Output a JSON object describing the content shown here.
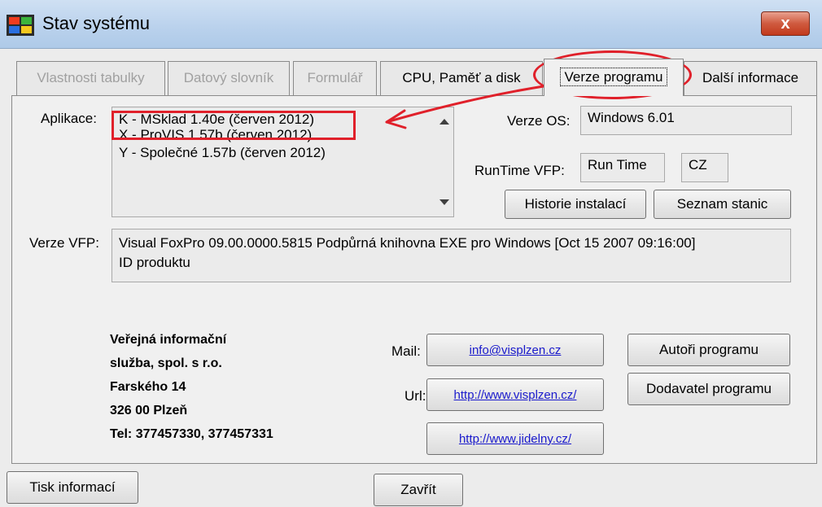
{
  "window": {
    "title": "Stav systému",
    "close": "x"
  },
  "tabs": [
    {
      "label": "Vlastnosti tabulky",
      "enabled": false
    },
    {
      "label": "Datový slovník",
      "enabled": false
    },
    {
      "label": "Formulář",
      "enabled": false
    },
    {
      "label": "CPU, Paměť a disk",
      "enabled": true
    },
    {
      "label": "Verze programu",
      "enabled": true,
      "active": true
    },
    {
      "label": "Další informace",
      "enabled": true
    }
  ],
  "applications": {
    "label": "Aplikace:",
    "items": [
      "K - MSklad 1.40e  (červen 2012)",
      "X - ProVIS 1.57b (červen 2012)",
      "Y - Společné 1.57b (červen 2012)"
    ]
  },
  "os": {
    "label": "Verze OS:",
    "value": "Windows 6.01"
  },
  "runtime": {
    "label": "RunTime VFP:",
    "value": "Run Time",
    "lang": "CZ"
  },
  "buttons": {
    "history": "Historie instalací",
    "stations": "Seznam stanic",
    "authors": "Autoři programu",
    "supplier": "Dodavatel programu",
    "print": "Tisk informací",
    "close": "Zavřít"
  },
  "vfp": {
    "label": "Verze VFP:",
    "line1": "Visual FoxPro 09.00.0000.5815 Podpůrná knihovna EXE  pro Windows [Oct 15 2007 09:16:00]",
    "line2": "ID produktu"
  },
  "company": {
    "line1": "Veřejná informační",
    "line2": "služba, spol. s r.o.",
    "line3": "Farského 14",
    "line4": "326 00  Plzeň",
    "line5": "Tel: 377457330, 377457331"
  },
  "contact": {
    "mail_label": "Mail:",
    "mail": "info@visplzen.cz",
    "url_label": "Url:",
    "url1": "http://www.visplzen.cz/",
    "url2": "http://www.jidelny.cz/"
  },
  "colors": {
    "annotation": "#e0202a",
    "link": "#1a1acc"
  }
}
